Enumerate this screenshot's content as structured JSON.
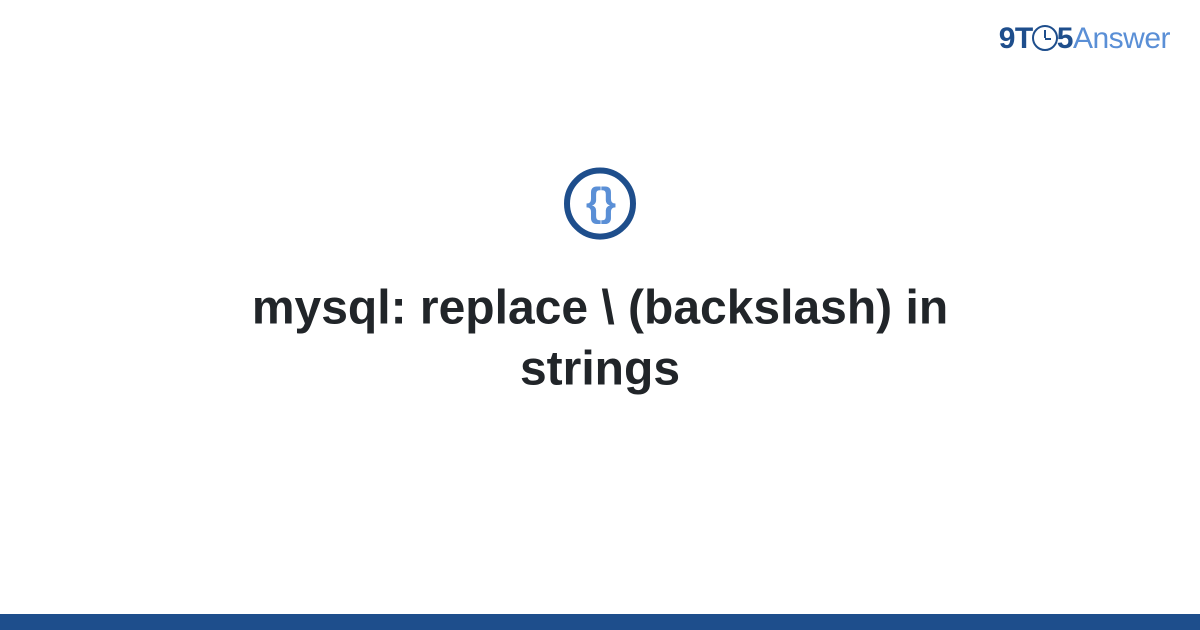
{
  "logo": {
    "part1": "9T",
    "part2": "5",
    "part3": "Answer"
  },
  "icon": {
    "braces": "{ }"
  },
  "title": "mysql: replace \\ (backslash) in strings"
}
